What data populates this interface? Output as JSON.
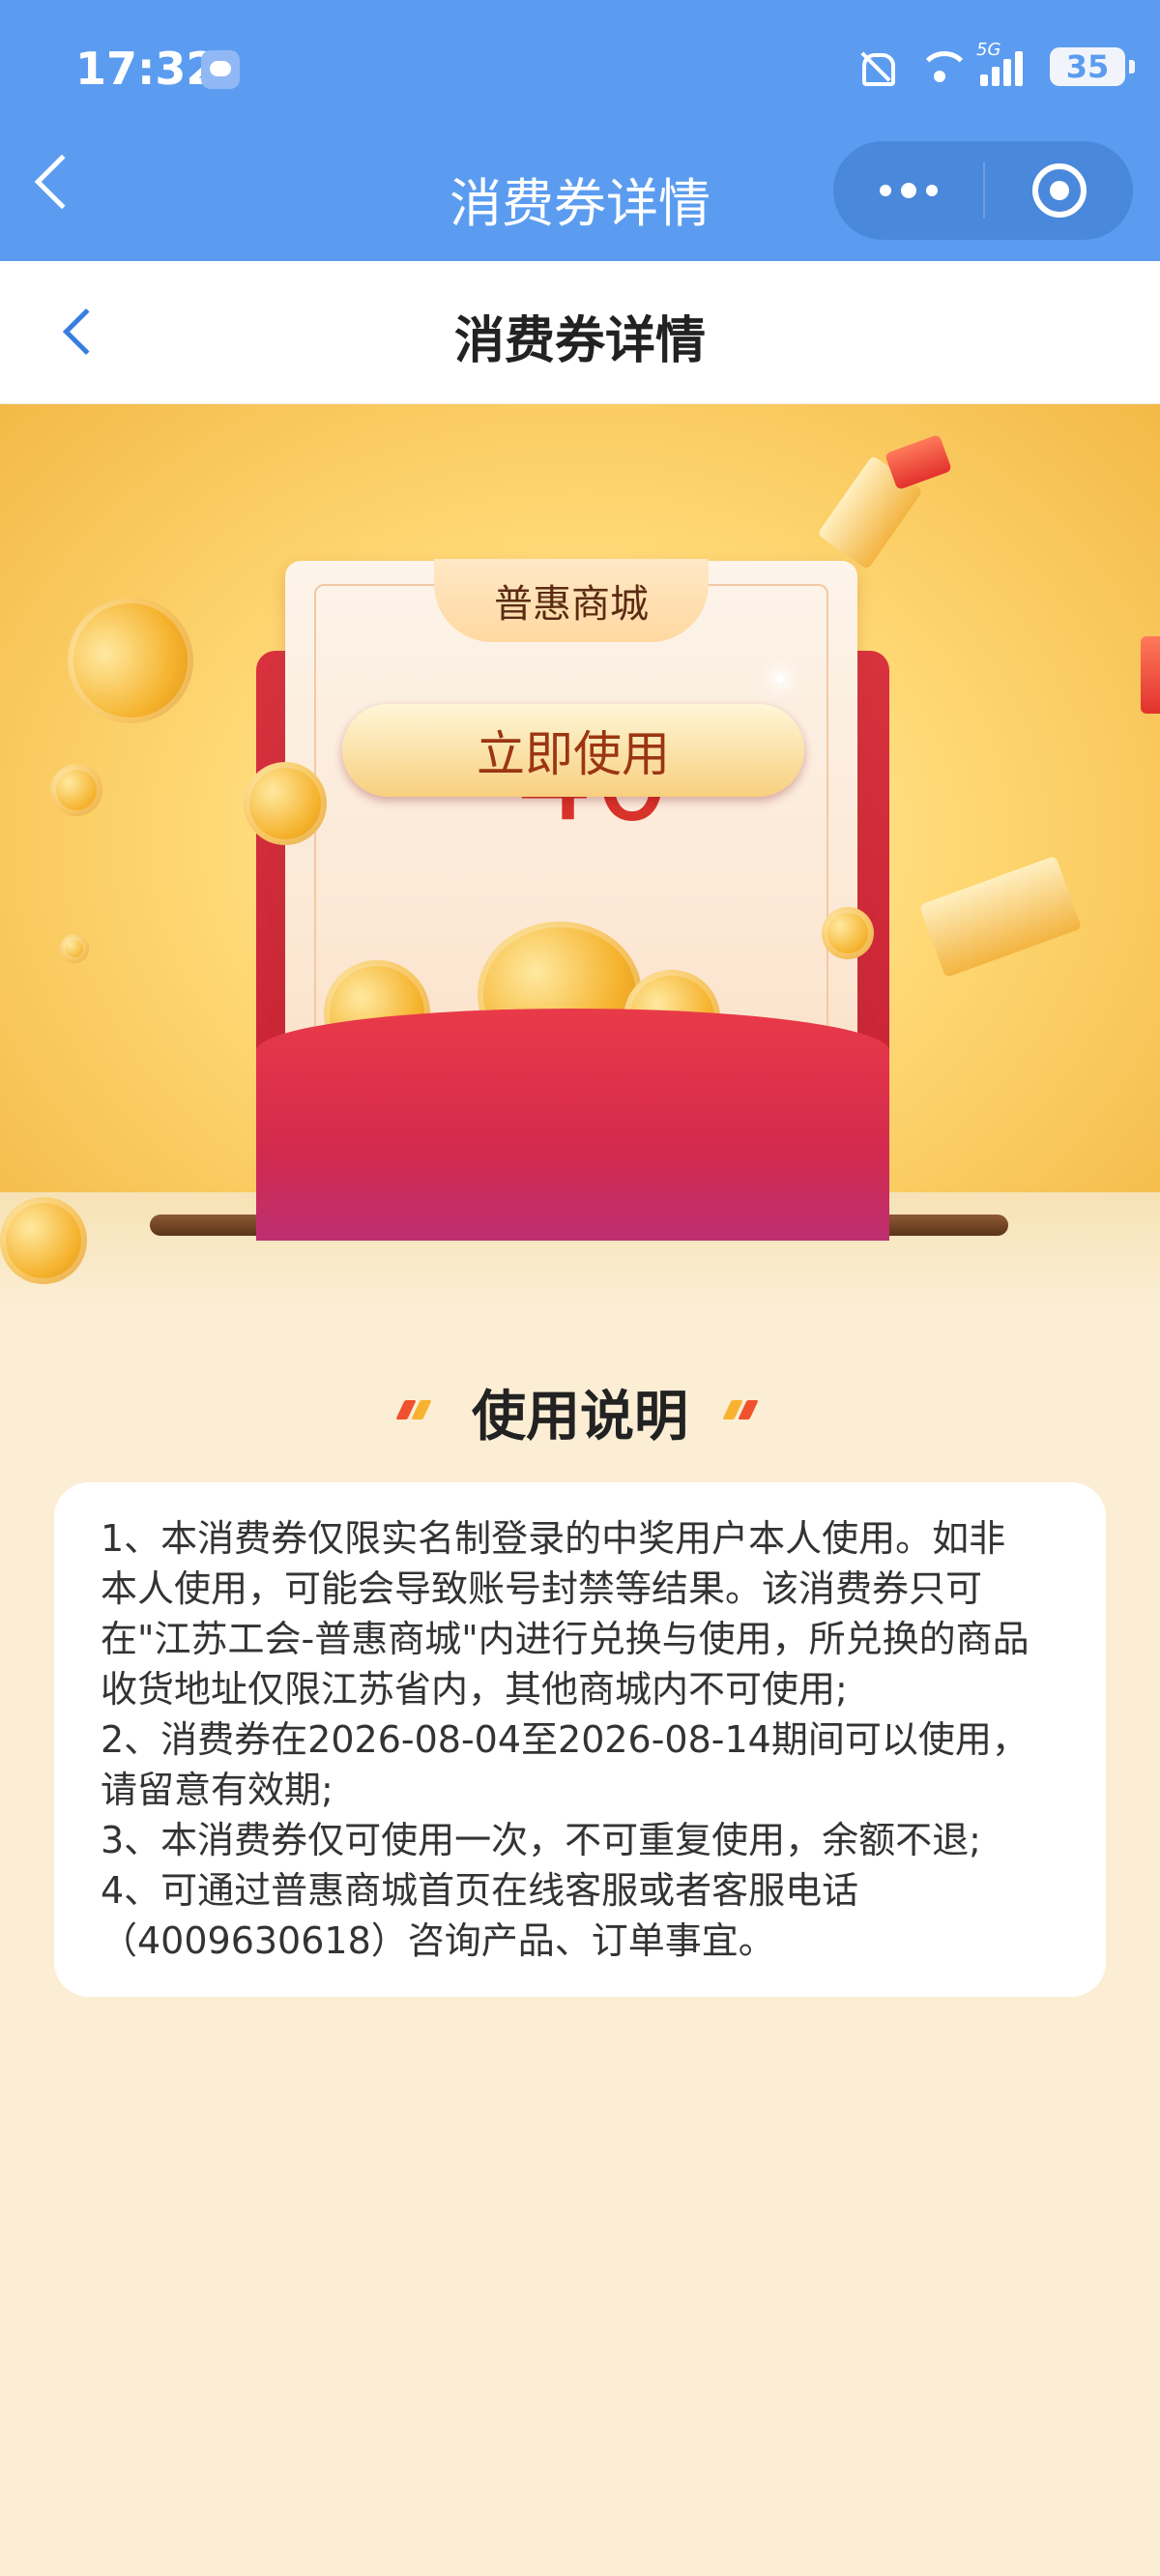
{
  "status_bar": {
    "time": "17:32",
    "network": "5G",
    "battery": "35",
    "icons": [
      "message-icon",
      "mute-icon",
      "wifi-icon",
      "signal-icon",
      "battery-icon"
    ]
  },
  "mini_program": {
    "title": "消费券详情"
  },
  "page": {
    "title": "消费券详情"
  },
  "coupon": {
    "store": "普惠商城",
    "currency_symbol": "¥",
    "amount": "40",
    "use_button": "立即使用"
  },
  "instructions": {
    "title": "使用说明",
    "lines": [
      "1、本消费券仅限实名制登录的中奖用户本人使用。如非",
      "本人使用，可能会导致账号封禁等结果。该消费券只可",
      "在\"江苏工会-普惠商城\"内进行兑换与使用，所兑换的商品",
      "收货地址仅限江苏省内，其他商城内不可使用;",
      "2、消费券在2026-08-04至2026-08-14期间可以使用，",
      "请留意有效期;",
      "3、本消费券仅可使用一次，不可重复使用，余额不退;",
      "4、可通过普惠商城首页在线客服或者客服电话",
      "（4009630618）咨询产品、订单事宜。"
    ]
  },
  "colors": {
    "header_blue": "#5b9cf0",
    "price_red": "#d8332a",
    "page_bg": "#fbeed5"
  }
}
